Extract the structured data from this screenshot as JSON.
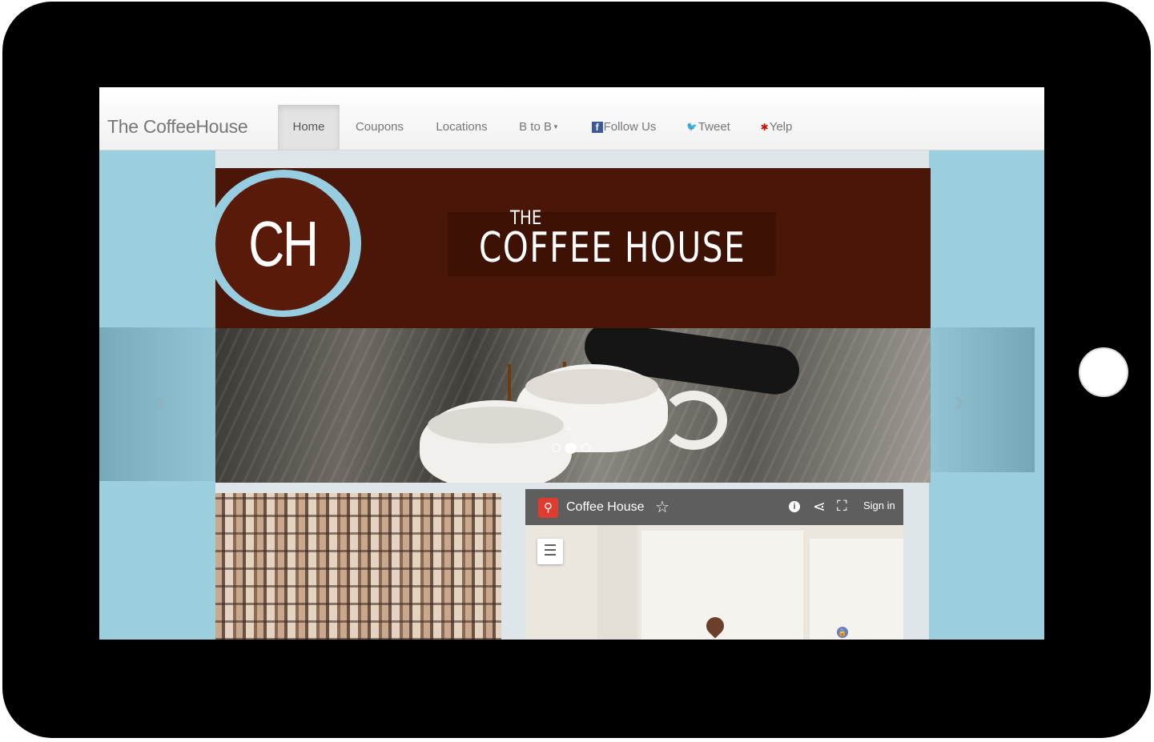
{
  "navbar": {
    "brand": "The CoffeeHouse",
    "items": [
      {
        "label": "Home",
        "active": true
      },
      {
        "label": "Coupons"
      },
      {
        "label": "Locations"
      },
      {
        "label": "B to B",
        "dropdown": true
      },
      {
        "label": "Follow Us",
        "icon": "facebook-icon"
      },
      {
        "label": "Tweet",
        "icon": "twitter-bird-icon"
      },
      {
        "label": "Yelp",
        "icon": "yelp-icon"
      }
    ]
  },
  "banner": {
    "logo_text": "CH",
    "title_small": "THE",
    "title_big": "COFFEE HOUSE"
  },
  "carousel": {
    "ellipsis": "...",
    "slide_count": 3,
    "active_slide": 2,
    "prev_icon": "chevron-left-icon",
    "next_icon": "chevron-right-icon"
  },
  "map": {
    "title": "Coffee House",
    "sign_in": "Sign in",
    "icons": [
      "map-pin-icon",
      "star-outline-icon",
      "info-icon",
      "share-icon",
      "fullscreen-icon",
      "list-icon"
    ]
  },
  "colors": {
    "banner_bg": "#4a1607",
    "page_bg": "#9ccfde",
    "map_header": "#5e5e5e",
    "map_pin": "#e03b2f"
  }
}
